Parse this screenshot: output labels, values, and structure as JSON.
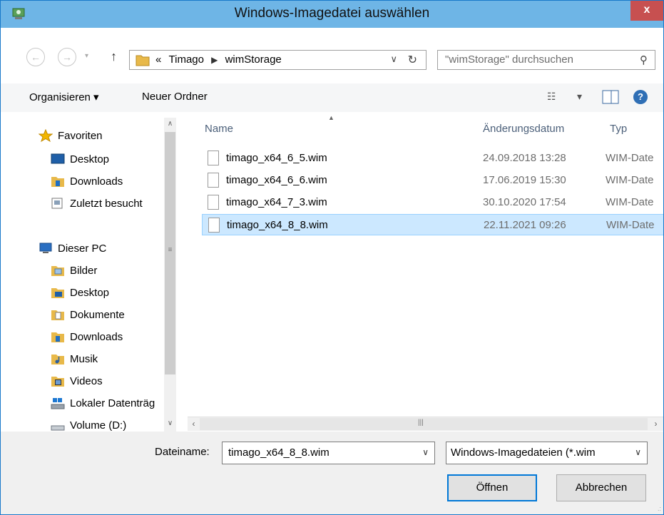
{
  "window": {
    "title": "Windows-Imagedatei auswählen",
    "close_glyph": "x"
  },
  "address": {
    "overflow": "«",
    "crumbs": [
      "Timago",
      "wimStorage"
    ]
  },
  "search": {
    "placeholder": "\"wimStorage\" durchsuchen"
  },
  "toolbar": {
    "organize": "Organisieren ▾",
    "new_folder": "Neuer Ordner"
  },
  "sidebar": {
    "favorites": "Favoriten",
    "fav_items": [
      "Desktop",
      "Downloads",
      "Zuletzt besucht"
    ],
    "pc": "Dieser PC",
    "pc_items": [
      "Bilder",
      "Desktop",
      "Dokumente",
      "Downloads",
      "Musik",
      "Videos",
      "Lokaler Datenträg",
      "Volume (D:)"
    ]
  },
  "columns": {
    "name": "Name",
    "date": "Änderungsdatum",
    "type": "Typ"
  },
  "files": [
    {
      "name": "timago_x64_6_5.wim",
      "date": "24.09.2018 13:28",
      "type": "WIM-Date",
      "selected": false
    },
    {
      "name": "timago_x64_6_6.wim",
      "date": "17.06.2019 15:30",
      "type": "WIM-Date",
      "selected": false
    },
    {
      "name": "timago_x64_7_3.wim",
      "date": "30.10.2020 17:54",
      "type": "WIM-Date",
      "selected": false
    },
    {
      "name": "timago_x64_8_8.wim",
      "date": "22.11.2021 09:26",
      "type": "WIM-Date",
      "selected": true
    }
  ],
  "footer": {
    "filename_label": "Dateiname:",
    "filename_value": "timago_x64_8_8.wim",
    "filetype_value": "Windows-Imagedateien (*.wim",
    "open": "Öffnen",
    "cancel": "Abbrechen"
  },
  "colors": {
    "title_bar": "#6eb5e6",
    "close_button": "#c75050",
    "selection": "#cce8ff",
    "column_header": "#4c607a"
  },
  "icons": [
    "folder-icon",
    "star-icon",
    "desktop-icon",
    "downloads-icon",
    "recent-icon",
    "computer-icon",
    "pictures-icon",
    "documents-icon",
    "music-icon",
    "videos-icon",
    "drive-icon",
    "file-icon",
    "help-icon"
  ]
}
